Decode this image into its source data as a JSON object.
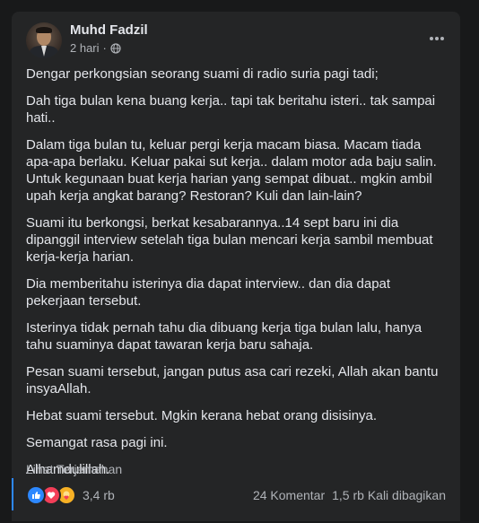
{
  "post": {
    "author": "Muhd Fadzil",
    "time": "2 hari",
    "separator": "·",
    "paragraphs": [
      "Dengar perkongsian seorang suami di radio suria pagi tadi;",
      "Dah tiga bulan kena buang kerja.. tapi tak beritahu isteri.. tak sampai hati..",
      "Dalam tiga bulan tu, keluar pergi kerja macam biasa. Macam tiada apa-apa berlaku. Keluar pakai sut kerja.. dalam motor ada baju salin. Untuk kegunaan buat kerja harian yang sempat dibuat.. mgkin ambil upah kerja angkat barang? Restoran? Kuli dan lain-lain?",
      "Suami itu berkongsi, berkat kesabarannya..14 sept baru ini dia dipanggil interview setelah tiga bulan mencari kerja sambil membuat kerja-kerja harian.",
      "Dia memberitahu isterinya dia dapat interview.. dan dia dapat pekerjaan tersebut.",
      "Isterinya tidak pernah tahu dia dibuang kerja tiga bulan lalu, hanya tahu suaminya dapat tawaran kerja baru sahaja.",
      "Pesan suami tersebut, jangan putus asa cari rezeki, Allah akan bantu insyaAllah.",
      "Hebat suami tersebut. Mgkin kerana hebat orang disisinya.",
      "Semangat rasa pagi ini.",
      "Alhamdulillah."
    ],
    "see_translation": "Lihat Terjemahan"
  },
  "footer": {
    "reactions_count": "3,4 rb",
    "comments": "24 Komentar",
    "shares": "1,5 rb Kali dibagikan",
    "reaction_icons": [
      "like-icon",
      "love-icon",
      "care-icon"
    ]
  },
  "colors": {
    "background": "#18191a",
    "card": "#242526",
    "primary_text": "#e4e6eb",
    "secondary_text": "#b0b3b8",
    "like": "#2d88ff",
    "love": "#f33e58",
    "care": "#f7b125"
  }
}
